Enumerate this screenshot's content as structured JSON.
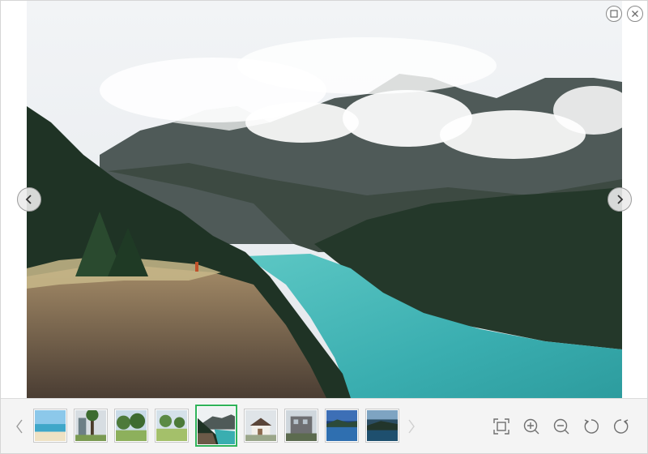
{
  "window": {
    "maximize_icon": "maximize-icon",
    "close_icon": "close-icon"
  },
  "navigation": {
    "prev_icon": "chevron-left-icon",
    "next_icon": "chevron-right-icon"
  },
  "main_image": {
    "subject": "mountain-lake-landscape",
    "colors": {
      "sky": "#eef1f3",
      "lake": "#3aaeb0",
      "forest": "#24382a",
      "rock": "#6b5a48"
    }
  },
  "thumbnails": [
    {
      "subject": "beach",
      "active": false
    },
    {
      "subject": "palm-tree-building",
      "active": false
    },
    {
      "subject": "park-trees",
      "active": false
    },
    {
      "subject": "park-field",
      "active": false
    },
    {
      "subject": "mountain-lake",
      "active": true
    },
    {
      "subject": "house",
      "active": false
    },
    {
      "subject": "building-street",
      "active": false
    },
    {
      "subject": "lake-blue",
      "active": false
    },
    {
      "subject": "coast-dark",
      "active": false
    }
  ],
  "tools": {
    "fit_icon": "fit-screen-icon",
    "zoom_in_icon": "zoom-in-icon",
    "zoom_out_icon": "zoom-out-icon",
    "rotate_left_icon": "rotate-left-icon",
    "rotate_right_icon": "rotate-right-icon"
  },
  "accent_color": "#2fb35a"
}
